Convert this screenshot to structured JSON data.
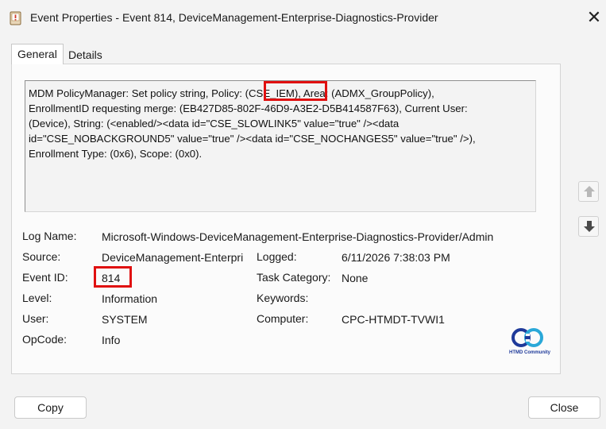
{
  "window": {
    "title": "Event Properties - Event 814, DeviceManagement-Enterprise-Diagnostics-Provider",
    "close_glyph": "✕"
  },
  "tabs": [
    {
      "label": "General",
      "selected": true
    },
    {
      "label": "Details",
      "selected": false
    }
  ],
  "description": {
    "lines": [
      "MDM PolicyManager: Set policy string, Policy: (CSE_IEM), Area: (ADMX_GroupPolicy),",
      "EnrollmentID requesting merge: (EB427D85-802F-46D9-A3E2-D5B414587F63), Current User:",
      "(Device), String: (<enabled/><data id=\"CSE_SLOWLINK5\" value=\"true\" /><data",
      "id=\"CSE_NOBACKGROUND5\" value=\"true\" /><data id=\"CSE_NOCHANGES5\" value=\"true\" />),",
      "Enrollment Type: (0x6), Scope: (0x0)."
    ]
  },
  "fields": {
    "log_name": {
      "label": "Log Name:",
      "value": "Microsoft-Windows-DeviceManagement-Enterprise-Diagnostics-Provider/Admin"
    },
    "source": {
      "label": "Source:",
      "value": "DeviceManagement-Enterpri"
    },
    "logged": {
      "label": "Logged:",
      "value": "6/11/2026 7:38:03 PM"
    },
    "event_id": {
      "label": "Event ID:",
      "value": "814"
    },
    "task_category": {
      "label": "Task Category:",
      "value": "None"
    },
    "level": {
      "label": "Level:",
      "value": "Information"
    },
    "keywords": {
      "label": "Keywords:",
      "value": ""
    },
    "user": {
      "label": "User:",
      "value": "SYSTEM"
    },
    "computer": {
      "label": "Computer:",
      "value": "CPC-HTMDT-TVWI1"
    },
    "opcode": {
      "label": "OpCode:",
      "value": "Info"
    }
  },
  "logo": {
    "text": "HTMD Community"
  },
  "buttons": {
    "copy": "Copy",
    "close": "Close"
  },
  "colors": {
    "highlight": "#e01010",
    "arrow": "#4a4a4a"
  },
  "icons": {
    "scroll_up": "arrow-up-icon",
    "scroll_down": "arrow-down-icon",
    "app": "event-viewer-icon",
    "close": "close-icon"
  }
}
